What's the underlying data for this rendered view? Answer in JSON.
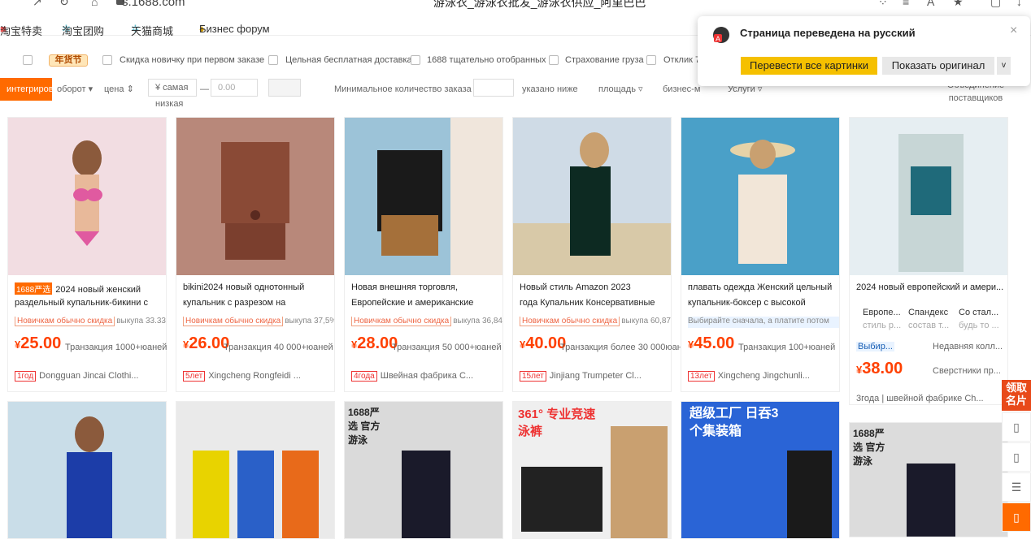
{
  "browser": {
    "url": "s.1688.com",
    "page_title": "游泳衣_游泳衣批发_游泳衣供应_阿里巴巴"
  },
  "bookmarks": [
    "淘宝特卖",
    "淘宝团购",
    "天猫商城",
    "Бизнес форум"
  ],
  "filters": {
    "badge": "年货节",
    "items": [
      "Скидка новичку при первом заказе",
      "Цельная бесплатная доставка",
      "1688 тщательно отобранных",
      "Страхование груза",
      "Отклик 7"
    ]
  },
  "sort": {
    "active": "интегрированный",
    "turnover": "оборот",
    "price": "цена",
    "price_min_placeholder": "¥ самая низкая",
    "dash": "—",
    "price_max_placeholder": "0.00",
    "moq": "Минимальное количество заказа",
    "below": "указано ниже",
    "area": "площадь",
    "business": "бизнес-м",
    "services": "Услуги",
    "merge": "Объединение поставщиков"
  },
  "popup": {
    "title": "Страница переведена на русский",
    "translate_images": "Перевести все картинки",
    "show_original": "Показать оригинал",
    "chevron": "v",
    "close": "×"
  },
  "products": [
    {
      "tag": "1688严选",
      "t1": "2024 новый женский",
      "t2": "раздельный купальник-бикини с",
      "promo": "Новичкам обычно скидка",
      "rate": "выкупа 33.33%",
      "price": "25.00",
      "deal": "Транзакция 1000+юаней",
      "year": "1год",
      "supplier": "Dongguan Jincai Clothi...",
      "img_color": "#f2dde2"
    },
    {
      "tag": "",
      "t1": "bikini2024 новый однотонный",
      "t2": "купальник с разрезом на",
      "promo": "Новичкам обычно скидка",
      "rate": "выкупа 37,5%",
      "price": "26.00",
      "deal": "Транзакция 40 000+юаней",
      "year": "5лет",
      "supplier": "Xingcheng Rongfeidi ...",
      "img_color": "#b8887a"
    },
    {
      "tag": "",
      "t1": "Новая внешняя торговля,",
      "t2": "Европейские и американские",
      "promo": "Новичкам обычно скидка",
      "rate": "выкупа 36,84%",
      "price": "28.00",
      "deal": "Транзакция 50 000+юаней",
      "year": "4года",
      "supplier": "Швейная фабрика С...",
      "img_color": "#9cc3d8"
    },
    {
      "tag": "",
      "t1": "Новый стиль Amazon 2023",
      "t2": "года Купальник Консервативные",
      "promo": "Новичкам обычно скидка",
      "rate": "выкупа 60,87%",
      "price": "40.00",
      "deal": "Транзакция более 30 000юаней",
      "year": "15лет",
      "supplier": "Jinjiang Trumpeter Cl...",
      "img_color": "#cfdbe6"
    },
    {
      "tag": "",
      "t1": "плавать одежда Женский цельный",
      "t2": "купальник-боксер с высокой",
      "promo": "Выбирайте сначала, а платите потом",
      "rate": "",
      "price": "45.00",
      "deal": "Транзакция 100+юаней",
      "year": "13лет",
      "supplier": "Xingcheng Jingchunli...",
      "img_color": "#4aa0c8"
    },
    {
      "tag": "",
      "t1": "2024 новый европейский и амери...",
      "t2": "",
      "promo": "",
      "rate": "",
      "price": "38.00",
      "deal": "",
      "year": "3года",
      "supplier": "швейной фабрике Ch...",
      "img_color": "#e6eef2"
    }
  ],
  "card6_extra": {
    "a": "Европе...",
    "b": "Спандекс",
    "c": "Со стал...",
    "d": "стиль р...",
    "e": "состав т...",
    "f": "будь то ...",
    "g": "Выбир...",
    "h": "Недавняя колл...",
    "i": "Сверстники пр..."
  },
  "row2": [
    {
      "label": "",
      "img_color": "#c9dde8"
    },
    {
      "label": "",
      "img_color": "#eaeaea"
    },
    {
      "label": "1688严选 官方游泳",
      "img_color": "#dadada"
    },
    {
      "label": "361° 专业竞速泳裤",
      "img_color": "#efefef"
    },
    {
      "label": "超级工厂 日吞3个集装箱",
      "img_color": "#2a64d6"
    },
    {
      "label": "1688严选 官方游泳",
      "img_color": "#dcdcdc"
    }
  ],
  "sidebar": {
    "card": "领取名片"
  }
}
